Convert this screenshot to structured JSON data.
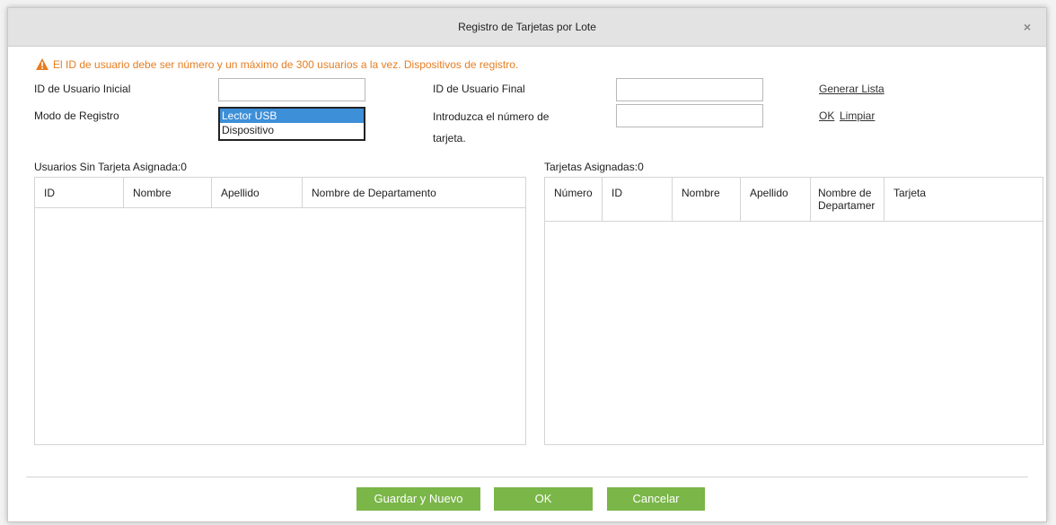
{
  "dialog": {
    "title": "Registro de Tarjetas por Lote",
    "close_icon": "×"
  },
  "warning": {
    "icon": "warning-triangle-icon",
    "text": "El ID de usuario debe ser número y un máximo de 300 usuarios a la vez. Dispositivos de registro."
  },
  "form": {
    "start_id_label": "ID de Usuario Inicial",
    "start_id_value": "",
    "end_id_label": "ID de Usuario Final",
    "end_id_value": "",
    "generate_list": "Generar Lista",
    "mode_label": "Modo de Registro",
    "mode_options": [
      "Lector USB",
      "Dispositivo"
    ],
    "mode_selected": "Lector USB",
    "card_label_line1": "Introduzca el número de",
    "card_label_line2": "tarjeta.",
    "card_value": "",
    "ok_link": "OK",
    "clear_link": "Limpiar"
  },
  "left_table": {
    "caption": "Usuarios Sin Tarjeta Asignada:0",
    "columns": [
      "ID",
      "Nombre",
      "Apellido",
      "Nombre de Departamento"
    ],
    "rows": []
  },
  "right_table": {
    "caption": "Tarjetas Asignadas:0",
    "columns": [
      "Número",
      "ID",
      "Nombre",
      "Apellido",
      "Nombre de Departamer",
      "Tarjeta"
    ],
    "dept_line1": "Nombre de",
    "dept_line2": "Departamer",
    "rows": []
  },
  "buttons": {
    "save_new": "Guardar y Nuevo",
    "ok": "OK",
    "cancel": "Cancelar"
  },
  "colors": {
    "accent_green": "#7ab648",
    "warning_orange": "#e67e22",
    "selection_blue": "#3d8fd8"
  }
}
